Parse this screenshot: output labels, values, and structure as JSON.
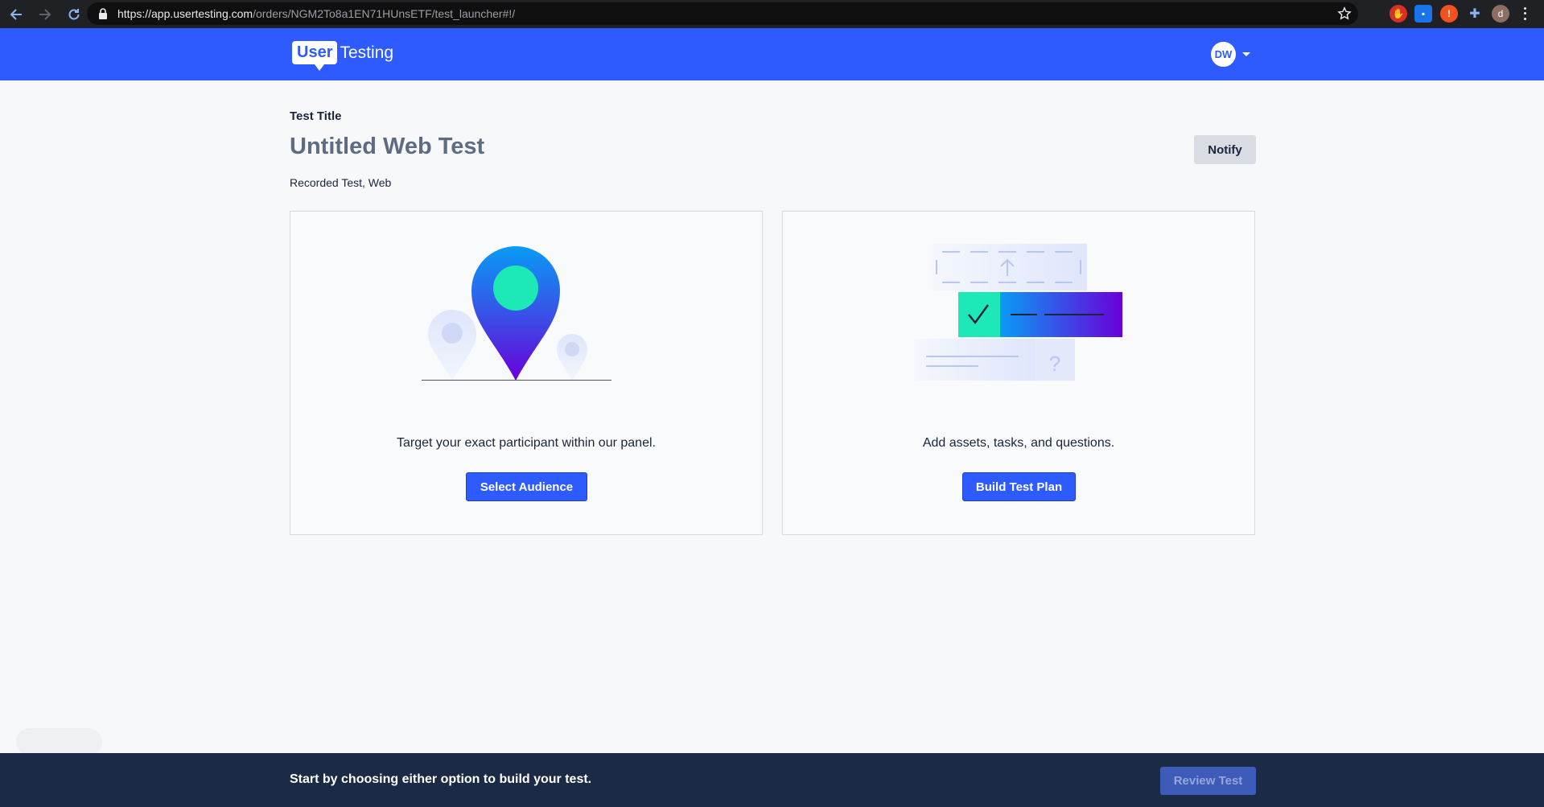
{
  "browser": {
    "url_host": "https://app.usertesting.com",
    "url_path": "/orders/NGM2To8a1EN71HUnsETF/test_launcher#!/",
    "profile_initial": "d"
  },
  "header": {
    "logo_user": "User",
    "logo_testing": "Testing",
    "avatar_initials": "DW"
  },
  "main": {
    "title_label": "Test Title",
    "test_title": "Untitled Web Test",
    "subtitle": "Recorded Test, Web",
    "notify_label": "Notify"
  },
  "cards": {
    "audience": {
      "description": "Target your exact participant within our panel.",
      "button_label": "Select Audience"
    },
    "test_plan": {
      "description": "Add assets, tasks, and questions.",
      "button_label": "Build Test Plan"
    }
  },
  "footer": {
    "message": "Start by choosing either option to build your test.",
    "review_label": "Review Test"
  },
  "colors": {
    "brand_blue": "#2d5bff",
    "footer_navy": "#1c2b45",
    "accent_green": "#1de9b6",
    "accent_purple": "#6a00d9"
  }
}
